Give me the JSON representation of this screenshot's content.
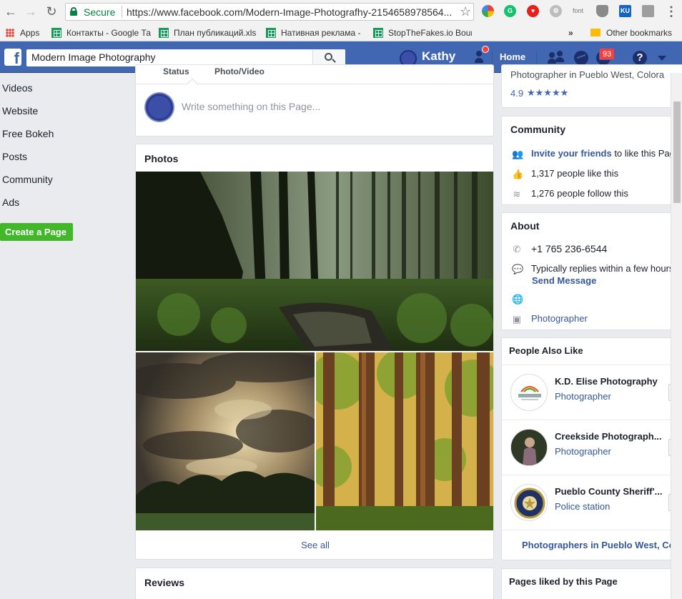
{
  "browser": {
    "secure_label": "Secure",
    "url": "https://www.facebook.com/Modern-Image-Photografhy-2154658978564...",
    "notif_ext_badge": "font",
    "ku_ext_label": "KU",
    "bookmarks": [
      {
        "label": "Apps"
      },
      {
        "label": "Контакты - Google Та"
      },
      {
        "label": "План публикаций.xls"
      },
      {
        "label": "Нативная реклама -"
      },
      {
        "label": "StopTheFakes.io Boun"
      }
    ],
    "more_bookmarks": "»",
    "other_bookmarks": "Other bookmarks"
  },
  "fb_header": {
    "logo": "f",
    "search_value": "Modern Image Photography",
    "user_name": "Kathy",
    "home_label": "Home",
    "notifications_count": "93",
    "help_label": "?"
  },
  "left_nav": {
    "items": [
      "Videos",
      "Website",
      "Free Bokeh",
      "Posts",
      "Community",
      "Ads"
    ],
    "create_page": "Create a Page"
  },
  "composer": {
    "tab_status": "Status",
    "tab_photo": "Photo/Video",
    "placeholder": "Write something on this Page..."
  },
  "photos": {
    "title": "Photos",
    "see_all": "See all"
  },
  "reviews": {
    "title": "Reviews"
  },
  "info_top": {
    "category_text": "Photographer in Pueblo West, Colora",
    "rating": "4.9",
    "stars": "★★★★★"
  },
  "community": {
    "title": "Community",
    "invite_link": "Invite your friends",
    "invite_suffix": " to like this Pag",
    "likes": "1,317 people like this",
    "follows": "1,276 people follow this"
  },
  "about": {
    "title": "About",
    "phone": "+1 765 236-6544",
    "replies": "Typically replies within a few hours",
    "send_message": "Send Message",
    "website": "",
    "category": "Photographer"
  },
  "people_also_like": {
    "title": "People Also Like",
    "items": [
      {
        "name": "K.D. Elise Photography",
        "category": "Photographer"
      },
      {
        "name": "Creekside Photograph...",
        "category": "Photographer"
      },
      {
        "name": "Pueblo County Sheriff'...",
        "category": "Police station"
      }
    ],
    "footer_link": "Photographers in Pueblo West, Co"
  },
  "pages_liked": {
    "title": "Pages liked by this Page"
  },
  "colors": {
    "fb_blue": "#4267b2",
    "link_blue": "#365899",
    "green_button": "#42b72a",
    "secure_green": "#0b8043",
    "badge_red": "#fa3e3e"
  }
}
